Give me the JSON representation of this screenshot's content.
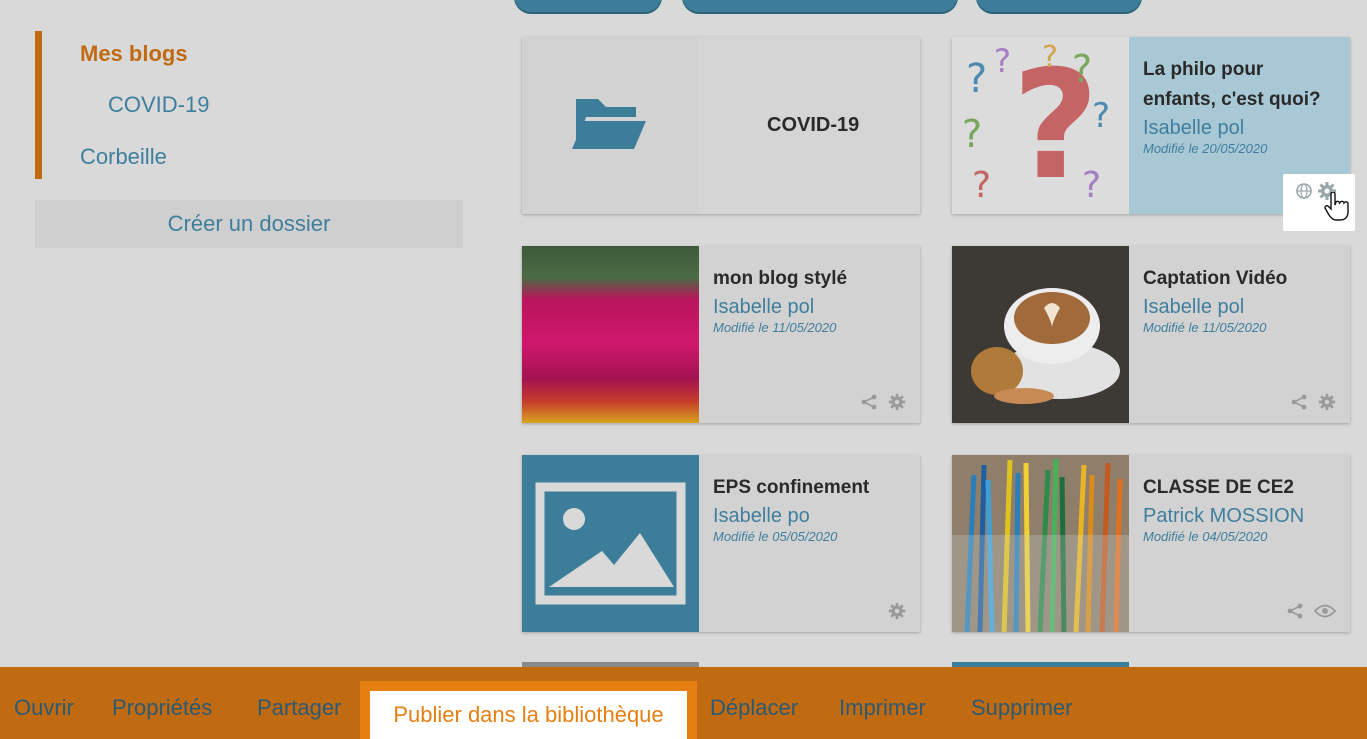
{
  "sidebar": {
    "items": [
      {
        "label": "Mes blogs",
        "active": true
      },
      {
        "label": "COVID-19",
        "active": false
      },
      {
        "label": "Corbeille",
        "active": false
      }
    ],
    "create_folder_label": "Créer un dossier"
  },
  "folder_card": {
    "title": "COVID-19",
    "icon": "folder-open-icon"
  },
  "blogs": [
    {
      "title_line1": "La philo pour",
      "title_line2": "enfants, c'est quoi?",
      "author": "Isabelle pol",
      "modified": "Modifié le 20/05/2020",
      "icons": [
        "globe-icon",
        "gear-icon"
      ]
    },
    {
      "title_line1": "mon blog stylé",
      "author": "Isabelle pol",
      "modified": "Modifié le 11/05/2020",
      "icons": [
        "share-icon",
        "gear-icon"
      ]
    },
    {
      "title_line1": "Captation Vidéo",
      "author": "Isabelle pol",
      "modified": "Modifié le 11/05/2020",
      "icons": [
        "share-icon",
        "gear-icon"
      ]
    },
    {
      "title_line1": "EPS confinement",
      "author": "Isabelle po",
      "modified": "Modifié le 05/05/2020",
      "icons": [
        "gear-icon"
      ]
    },
    {
      "title_line1": "CLASSE DE CE2",
      "author": "Patrick MOSSION",
      "modified": "Modifié le 04/05/2020",
      "icons": [
        "share-icon",
        "eye-icon"
      ]
    }
  ],
  "bottom_menu": {
    "items": [
      "Ouvrir",
      "Propriétés",
      "Partager",
      "Publier dans la bibliothèque",
      "Déplacer",
      "Imprimer",
      "Supprimer"
    ],
    "active_index": 3
  },
  "colors": {
    "accent_orange": "#e67f12",
    "link_blue": "#3f7f9d",
    "overlay_bg": "#d9d9d9"
  }
}
